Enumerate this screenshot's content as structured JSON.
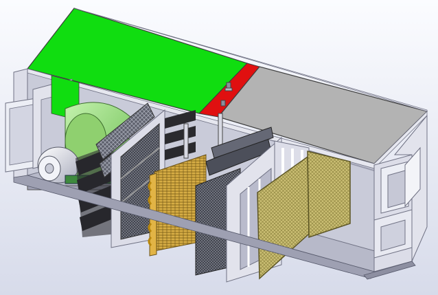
{
  "scene": {
    "description_visible_text": "",
    "colors": {
      "background_top": "#f7f8fc",
      "background_bottom": "#d9dcec",
      "panel_green": "#10dd10",
      "panel_red": "#e01010",
      "panel_grey": "#b3b3b3",
      "frame_light": "#dadbe6",
      "frame_mid": "#b9bbcc",
      "frame_dark": "#6f7183",
      "fan_green": "#9be07c",
      "motor_white": "#e8eaf2",
      "baffle_black": "#222226",
      "mesh_dark": "#4a4d58",
      "coil_gold": "#c7a033",
      "coil_copper": "#8a6a1a",
      "pad_khaki": "#c9bd72"
    }
  }
}
